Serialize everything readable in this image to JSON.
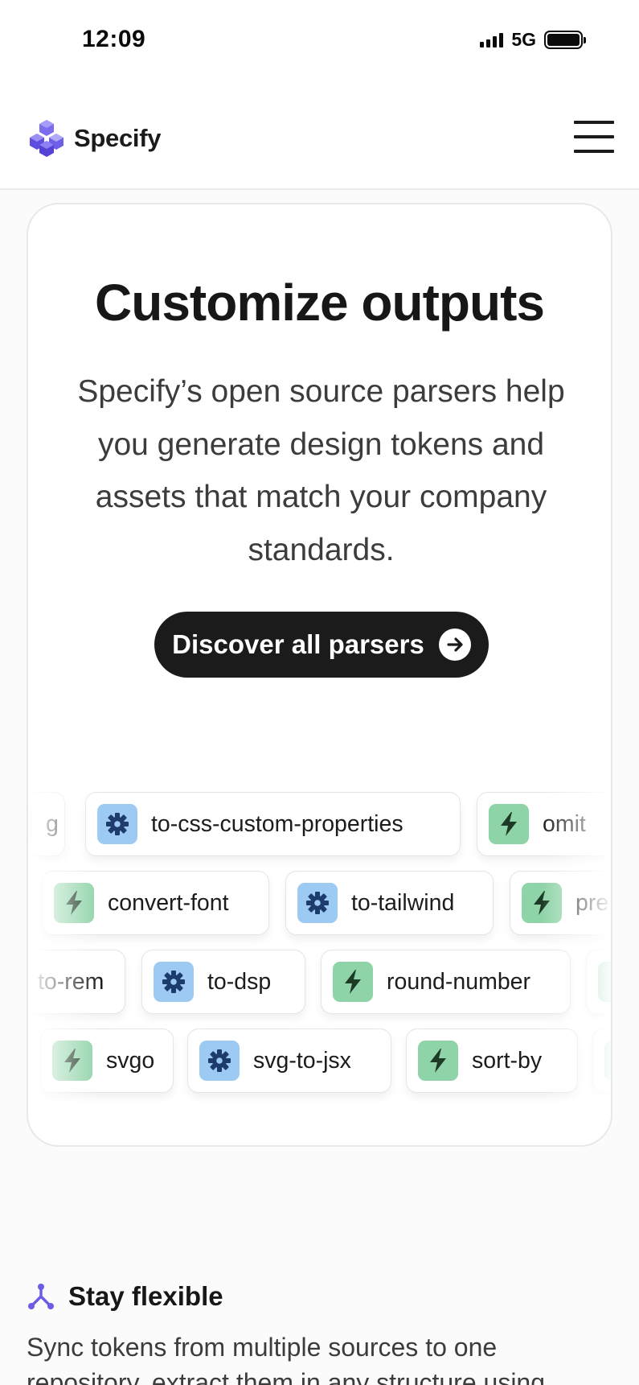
{
  "status_bar": {
    "time": "12:09",
    "network": "5G",
    "signal_icon": "signal-bars-icon",
    "battery_icon": "battery-full-icon"
  },
  "nav": {
    "logo_text": "Specify",
    "logo_icon": "specify-cube-logo",
    "menu_icon": "hamburger-menu-icon"
  },
  "card": {
    "title": "Customize outputs",
    "description": "Specify’s open source parsers help you generate design tokens and assets that match your company standards.",
    "cta_label": "Discover all parsers",
    "cta_icon": "arrow-right-circle-icon"
  },
  "chips": {
    "row1": [
      {
        "label": "g",
        "icon": "bolt-icon"
      },
      {
        "label": "to-css-custom-properties",
        "icon": "gear-icon"
      },
      {
        "label": "omit",
        "icon": "bolt-icon"
      }
    ],
    "row2": [
      {
        "label": "convert-font",
        "icon": "bolt-icon"
      },
      {
        "label": "to-tailwind",
        "icon": "gear-icon"
      },
      {
        "label": "pre",
        "icon": "bolt-icon"
      }
    ],
    "row3": [
      {
        "label": "to-rem",
        "icon": "bolt-icon"
      },
      {
        "label": "to-dsp",
        "icon": "gear-icon"
      },
      {
        "label": "round-number",
        "icon": "bolt-icon"
      },
      {
        "label": "",
        "icon": "bolt-icon"
      }
    ],
    "row4": [
      {
        "label": "svgo",
        "icon": "bolt-icon"
      },
      {
        "label": "svg-to-jsx",
        "icon": "gear-icon"
      },
      {
        "label": "sort-by",
        "icon": "bolt-icon"
      },
      {
        "label": "",
        "icon": "bolt-icon"
      }
    ]
  },
  "flexible": {
    "icon": "branch-merge-icon",
    "title": "Stay flexible",
    "body": "Sync tokens from multiple sources to one repository, extract them in any structure using"
  },
  "colors": {
    "gear_icon_bg": "#9ccaf2",
    "bolt_icon_bg": "#8fd3a8",
    "gear_icon_fg": "#1e3b6e",
    "bolt_icon_fg": "#1c3a26",
    "brand_purple": "#6b5ce7",
    "cta_bg": "#1b1b1b"
  }
}
